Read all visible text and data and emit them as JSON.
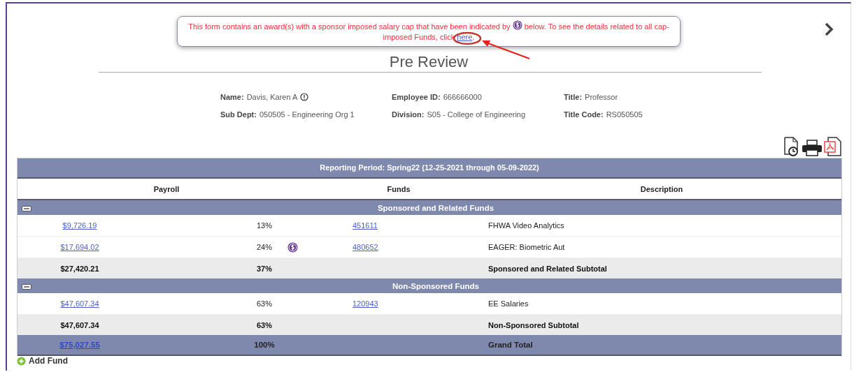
{
  "alert": {
    "text_before": "This form contains an award(s) with a sponsor imposed salary cap that have been indicated by",
    "text_after": "below. To see the details related to all cap-imposed Funds, click",
    "link": "here",
    "text_end": "."
  },
  "page_title": "Pre Review",
  "employee": [
    {
      "label": "Name:",
      "value": "Davis, Karen A",
      "info": true
    },
    {
      "label": "Employee ID:",
      "value": "666666000",
      "info": false
    },
    {
      "label": "Title:",
      "value": "Professor",
      "info": false
    },
    {
      "label": "Sub Dept:",
      "value": "050505 - Engineering Org 1",
      "info": false
    },
    {
      "label": "Division:",
      "value": "S05 - College of Engineering",
      "info": false
    },
    {
      "label": "Title Code:",
      "value": "RS050505",
      "info": false
    }
  ],
  "table": {
    "reporting_period": "Reporting Period: Spring22 (12-25-2021 through 05-09-2022)",
    "columns": [
      "Payroll",
      "Funds",
      "Description"
    ],
    "groups": [
      {
        "title": "Sponsored and Related Funds",
        "expanded": true,
        "rows": [
          {
            "amount": "$9,726.19",
            "percent": "13%",
            "capped": false,
            "fund": "451611",
            "description": "FHWA Video Analytics"
          },
          {
            "amount": "$17,694.02",
            "percent": "24%",
            "capped": true,
            "fund": "480652",
            "description": "EAGER: Biometric Aut"
          }
        ],
        "subtotal": {
          "amount": "$27,420.21",
          "percent": "37%",
          "label": "Sponsored and Related Subtotal"
        }
      },
      {
        "title": "Non-Sponsored Funds",
        "expanded": true,
        "rows": [
          {
            "amount": "$47,607.34",
            "percent": "63%",
            "capped": false,
            "fund": "120943",
            "description": "EE Salaries"
          }
        ],
        "subtotal": {
          "amount": "$47,607.34",
          "percent": "63%",
          "label": "Non-Sponsored Subtotal"
        }
      }
    ],
    "grand_total": {
      "amount": "$75,027.55",
      "percent": "100%",
      "label": "Grand Total"
    }
  },
  "add_fund": "Add Fund"
}
